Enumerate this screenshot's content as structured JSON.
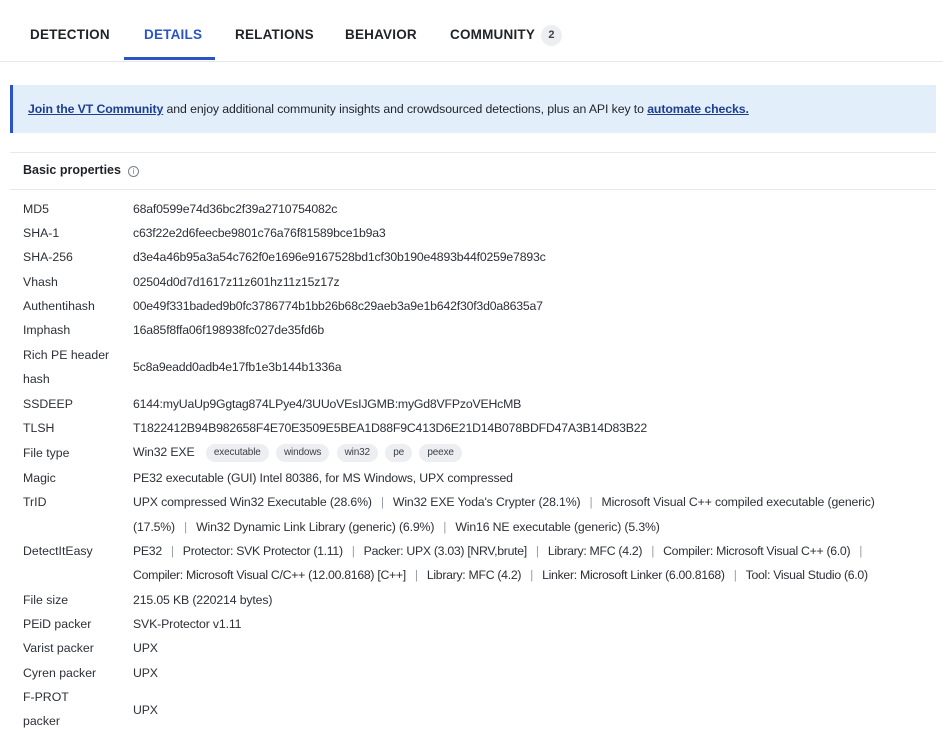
{
  "tabs": [
    {
      "label": "DETECTION"
    },
    {
      "label": "DETAILS",
      "active": true
    },
    {
      "label": "RELATIONS"
    },
    {
      "label": "BEHAVIOR"
    },
    {
      "label": "COMMUNITY",
      "count": "2"
    }
  ],
  "banner": {
    "link1": "Join the VT Community",
    "text": " and enjoy additional community insights and crowdsourced detections, plus an API key to ",
    "link2": "automate checks."
  },
  "basic_properties": {
    "title": "Basic properties",
    "info_icon": "info-icon",
    "md5": {
      "label": "MD5",
      "value": "68af0599e74d36bc2f39a2710754082c"
    },
    "sha1": {
      "label": "SHA-1",
      "value": "c63f22e2d6feecbe9801c76a76f81589bce1b9a3"
    },
    "sha256": {
      "label": "SHA-256",
      "value": "d3e4a46b95a3a54c762f0e1696e9167528bd1cf30b190e4893b44f0259e7893c"
    },
    "vhash": {
      "label": "Vhash",
      "value": "02504d0d7d1617z11z601hz11z15z17z"
    },
    "authentihash": {
      "label": "Authentihash",
      "value": "00e49f331baded9b0fc3786774b1bb26b68c29aeb3a9e1b642f30f3d0a8635a7"
    },
    "imphash": {
      "label": "Imphash",
      "value": "16a85f8ffa06f198938fc027de35fd6b"
    },
    "rich_pe": {
      "label_line1": "Rich PE header",
      "label_line2": "hash",
      "value": "5c8a9eadd0adb4e17fb1e3b144b1336a"
    },
    "ssdeep": {
      "label": "SSDEEP",
      "value": "6144:myUaUp9Ggtag874LPye4/3UUoVEsIJGMB:myGd8VFPzoVEHcMB"
    },
    "tlsh": {
      "label": "TLSH",
      "value": "T1822412B94B982658F4E70E3509E5BEA1D88F9C413D6E21D14B078BDFD47A3B14D83B22"
    },
    "file_type": {
      "label": "File type",
      "value": "Win32 EXE",
      "tags": [
        "executable",
        "windows",
        "win32",
        "pe",
        "peexe"
      ]
    },
    "magic": {
      "label": "Magic",
      "value": "PE32 executable (GUI) Intel 80386, for MS Windows, UPX compressed"
    },
    "trid": {
      "label": "TrID",
      "line1": [
        "UPX compressed Win32 Executable (28.6%)",
        "Win32 EXE Yoda's Crypter (28.1%)",
        "Microsoft Visual C++ compiled executable (generic)"
      ],
      "line2": [
        "(17.5%)",
        "Win32 Dynamic Link Library (generic) (6.9%)",
        "Win16 NE executable (generic) (5.3%)"
      ]
    },
    "detect_it_easy": {
      "label": "DetectItEasy",
      "line1": [
        "PE32",
        "Protector: SVK Protector (1.11)",
        "Packer: UPX (3.03) [NRV,brute]",
        "Library: MFC (4.2)",
        "Compiler: Microsoft Visual C++ (6.0)",
        ""
      ],
      "line2": [
        "Compiler: Microsoft Visual C/C++ (12.00.8168) [C++]",
        "Library: MFC (4.2)",
        "Linker: Microsoft Linker (6.00.8168)",
        "Tool: Visual Studio (6.0)"
      ]
    },
    "file_size": {
      "label": "File size",
      "value": "215.05 KB (220214 bytes)"
    },
    "peid": {
      "label": "PEiD packer",
      "value": "SVK-Protector v1.11"
    },
    "varist": {
      "label": "Varist packer",
      "value": "UPX"
    },
    "cyren": {
      "label": "Cyren packer",
      "value": "UPX"
    },
    "fprot": {
      "label_line1": "F-PROT",
      "label_line2": "packer",
      "value": "UPX"
    }
  }
}
